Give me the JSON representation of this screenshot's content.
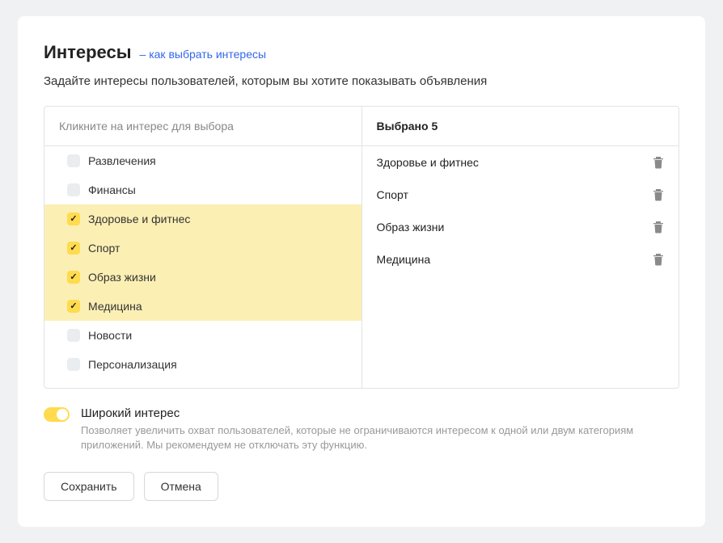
{
  "title": "Интересы",
  "help_link": "– как выбрать интересы",
  "subtitle": "Задайте интересы пользователей, которым вы хотите показывать объявления",
  "left_header": "Кликните на интерес для выбора",
  "right_header": "Выбрано 5",
  "interests": [
    {
      "label": "Развлечения",
      "checked": false
    },
    {
      "label": "Финансы",
      "checked": false
    },
    {
      "label": "Здоровье и фитнес",
      "checked": true
    },
    {
      "label": "Спорт",
      "checked": true
    },
    {
      "label": "Образ жизни",
      "checked": true
    },
    {
      "label": "Медицина",
      "checked": true
    },
    {
      "label": "Новости",
      "checked": false
    },
    {
      "label": "Персонализация",
      "checked": false
    }
  ],
  "selected": [
    {
      "label": "Здоровье и фитнес"
    },
    {
      "label": "Спорт"
    },
    {
      "label": "Образ жизни"
    },
    {
      "label": "Медицина"
    }
  ],
  "toggle": {
    "title": "Широкий интерес",
    "description": "Позволяет увеличить охват пользователей, которые не ограничиваются интересом к одной или двум категориям приложений. Мы рекомендуем не отключать эту функцию.",
    "on": true
  },
  "buttons": {
    "save": "Сохранить",
    "cancel": "Отмена"
  }
}
